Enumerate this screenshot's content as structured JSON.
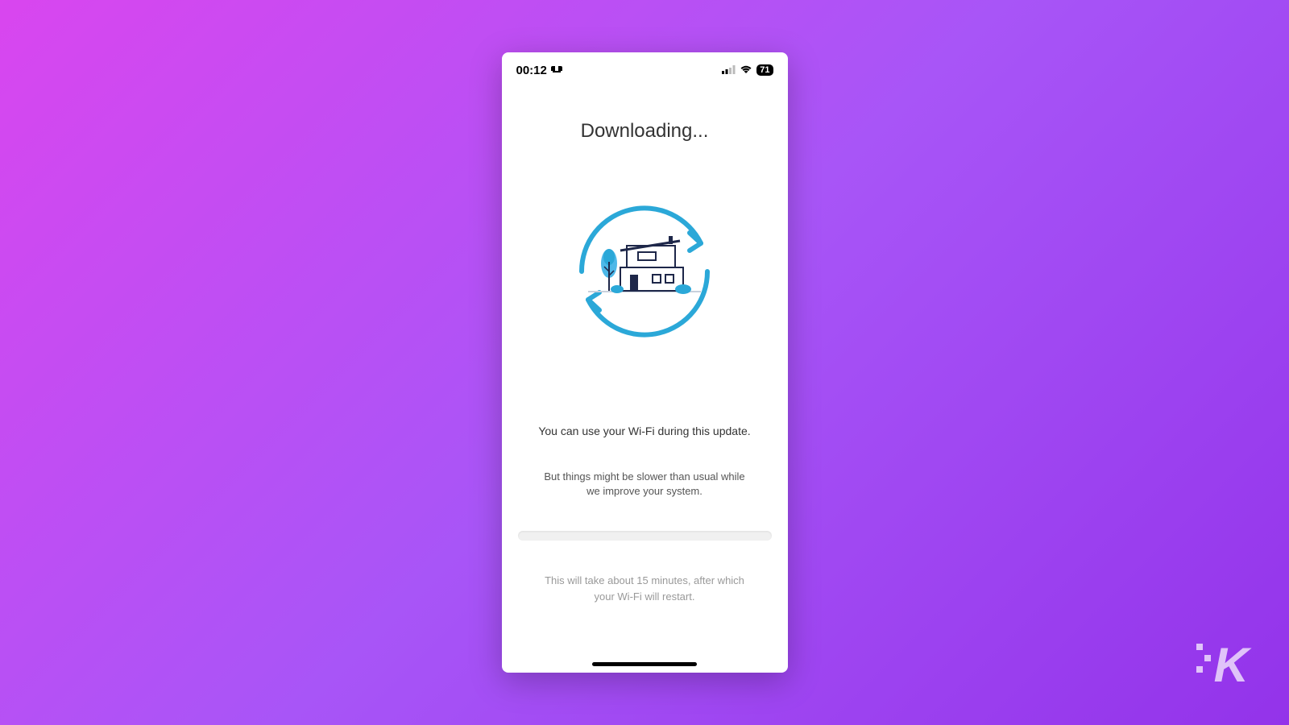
{
  "status_bar": {
    "time": "00:12",
    "alarm_icon": "alarm-icon",
    "signal_icon": "cellular-signal-icon",
    "wifi_icon": "wifi-icon",
    "battery_level": "71"
  },
  "screen": {
    "title": "Downloading...",
    "illustration": "house-refresh-icon",
    "info_primary": "You can use your Wi-Fi during this update.",
    "info_secondary": "But things might be slower than usual while we improve your system.",
    "footer": "This will take about 15 minutes, after which your Wi-Fi will restart."
  },
  "colors": {
    "accent_blue": "#2ba8d8",
    "dark_navy": "#1e2749"
  },
  "watermark": {
    "letter": "K"
  }
}
